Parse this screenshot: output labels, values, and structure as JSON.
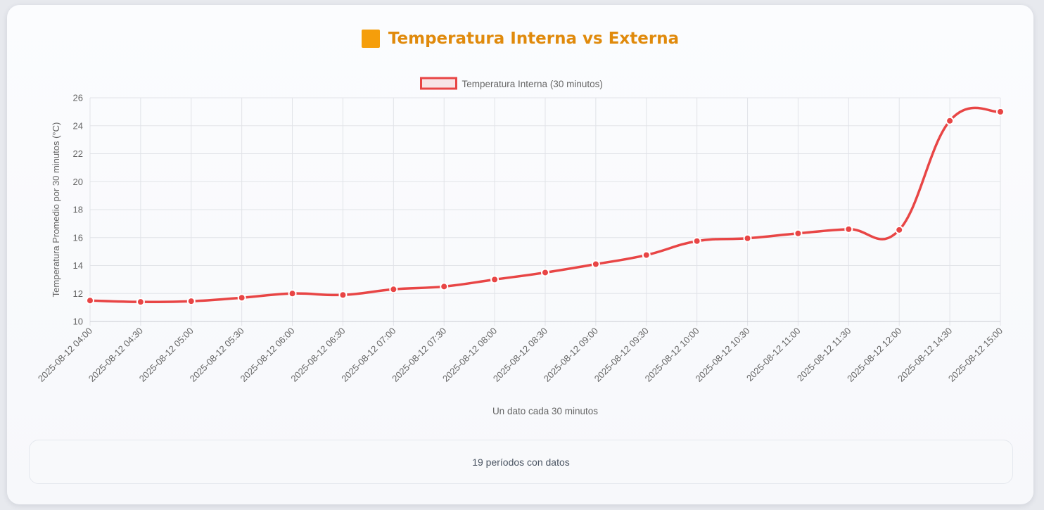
{
  "title": "Temperatura Interna vs Externa",
  "summary_text": "19 períodos con datos",
  "colors": {
    "title": "#e08a0c",
    "title_icon": "#f59e0b",
    "series": "#e84545"
  },
  "chart_data": {
    "type": "line",
    "ylabel": "Temperatura Promedio por 30 minutos (°C)",
    "xlabel": "Un dato cada 30 minutos",
    "ylim": [
      10,
      26
    ],
    "yticks": [
      10,
      12,
      14,
      16,
      18,
      20,
      22,
      24,
      26
    ],
    "grid": true,
    "legend_position": "top",
    "categories": [
      "2025-08-12 04:00",
      "2025-08-12 04:30",
      "2025-08-12 05:00",
      "2025-08-12 05:30",
      "2025-08-12 06:00",
      "2025-08-12 06:30",
      "2025-08-12 07:00",
      "2025-08-12 07:30",
      "2025-08-12 08:00",
      "2025-08-12 08:30",
      "2025-08-12 09:00",
      "2025-08-12 09:30",
      "2025-08-12 10:00",
      "2025-08-12 10:30",
      "2025-08-12 11:00",
      "2025-08-12 11:30",
      "2025-08-12 12:00",
      "2025-08-12 14:30",
      "2025-08-12 15:00"
    ],
    "series": [
      {
        "name": "Temperatura Interna (30 minutos)",
        "color": "#e84545",
        "values": [
          11.5,
          11.4,
          11.45,
          11.7,
          12.0,
          11.9,
          12.3,
          12.5,
          13.0,
          13.5,
          14.1,
          14.75,
          15.75,
          15.95,
          16.3,
          16.6,
          16.55,
          24.35,
          25.0
        ]
      }
    ]
  }
}
